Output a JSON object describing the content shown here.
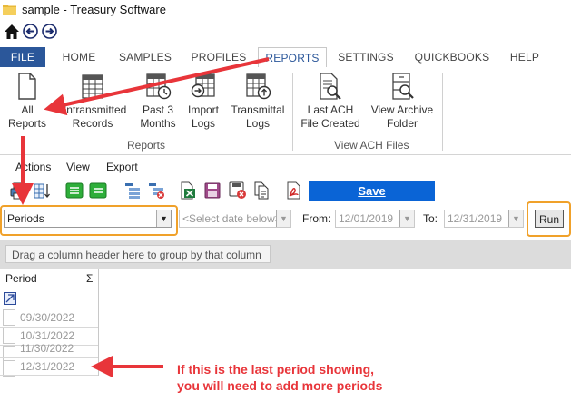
{
  "window": {
    "title": "sample - Treasury Software"
  },
  "tabs": [
    {
      "label": "FILE"
    },
    {
      "label": "HOME"
    },
    {
      "label": "SAMPLES"
    },
    {
      "label": "PROFILES"
    },
    {
      "label": "REPORTS"
    },
    {
      "label": "SETTINGS"
    },
    {
      "label": "QUICKBOOKS"
    },
    {
      "label": "HELP"
    }
  ],
  "ribbon": {
    "reports_buttons": [
      {
        "line1": "All",
        "line2": "Reports",
        "icon": "document-icon"
      },
      {
        "line1": "Untransmitted",
        "line2": "Records",
        "icon": "table-icon"
      },
      {
        "line1": "Past 3",
        "line2": "Months",
        "icon": "table-clock-icon"
      },
      {
        "line1": "Import",
        "line2": "Logs",
        "icon": "table-import-icon"
      },
      {
        "line1": "Transmittal",
        "line2": "Logs",
        "icon": "table-upload-icon"
      }
    ],
    "reports_group": "Reports",
    "ach_buttons": [
      {
        "line1": "Last ACH",
        "line2": "File Created",
        "icon": "document-search-icon"
      },
      {
        "line1": "View Archive",
        "line2": "Folder",
        "icon": "cabinet-search-icon"
      }
    ],
    "ach_group": "View ACH Files"
  },
  "menu": {
    "actions": "Actions",
    "view": "View",
    "export": "Export"
  },
  "toolbar": {
    "save_label": "Save"
  },
  "filters": {
    "report_select": "Periods",
    "date_select": "<Select date below>",
    "from_label": "From:",
    "from_value": "12/01/2019",
    "to_label": "To:",
    "to_value": "12/31/2019",
    "run_label": "Run"
  },
  "grid": {
    "group_hint": "Drag a column header here to group by that column",
    "column_header": "Period",
    "sigma": "Σ",
    "rows": [
      "09/30/2022",
      "10/31/2022",
      "11/30/2022",
      "12/31/2022"
    ]
  },
  "annotation": {
    "line1": "If this is the last period showing,",
    "line2": "you will need to add more periods",
    "color": "#e8353a"
  },
  "colors": {
    "file_tab": "#2b579a",
    "save_button": "#0a64d6",
    "highlight": "#f0a12a"
  }
}
